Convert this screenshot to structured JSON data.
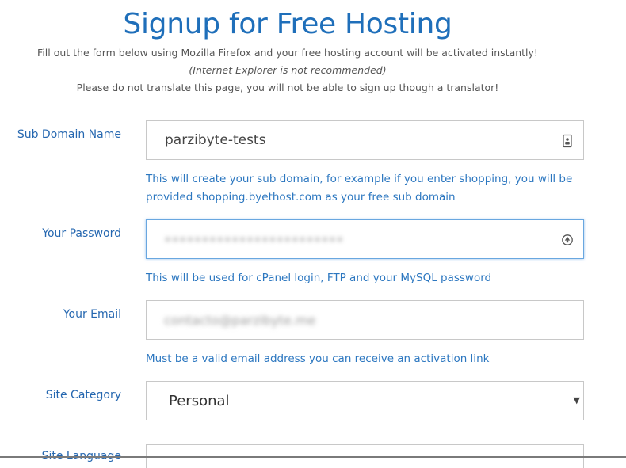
{
  "header": {
    "title": "Signup for Free Hosting",
    "intro_line1": "Fill out the form below using Mozilla Firefox and your free hosting account will be activated instantly!",
    "intro_line2": "(Internet Explorer is not recommended)",
    "intro_line3": "Please do not translate this page, you will not be able to sign up though a translator!"
  },
  "form": {
    "subdomain": {
      "label": "Sub Domain Name",
      "value": "parzibyte-tests",
      "help": "This will create your sub domain, for example if you enter shopping, you will be provided shopping.byethost.com as your free sub domain",
      "icon": "contact-card-icon"
    },
    "password": {
      "label": "Your Password",
      "masked_value": "••••••••••••••••••••••••",
      "help": "This will be used for cPanel login, FTP and your MySQL password",
      "icon": "password-reveal-icon"
    },
    "email": {
      "label": "Your Email",
      "masked_value": "contacto@parzibyte.me",
      "help": "Must be a valid email address you can receive an activation link"
    },
    "site_category": {
      "label": "Site Category",
      "value": "Personal",
      "icon": "dropdown-caret-icon"
    },
    "site_language": {
      "label": "Site Language"
    }
  },
  "colors": {
    "accent": "#1f6fba",
    "label": "#2567b0",
    "help": "#2c77c0",
    "focus_border": "#69a7e0"
  }
}
